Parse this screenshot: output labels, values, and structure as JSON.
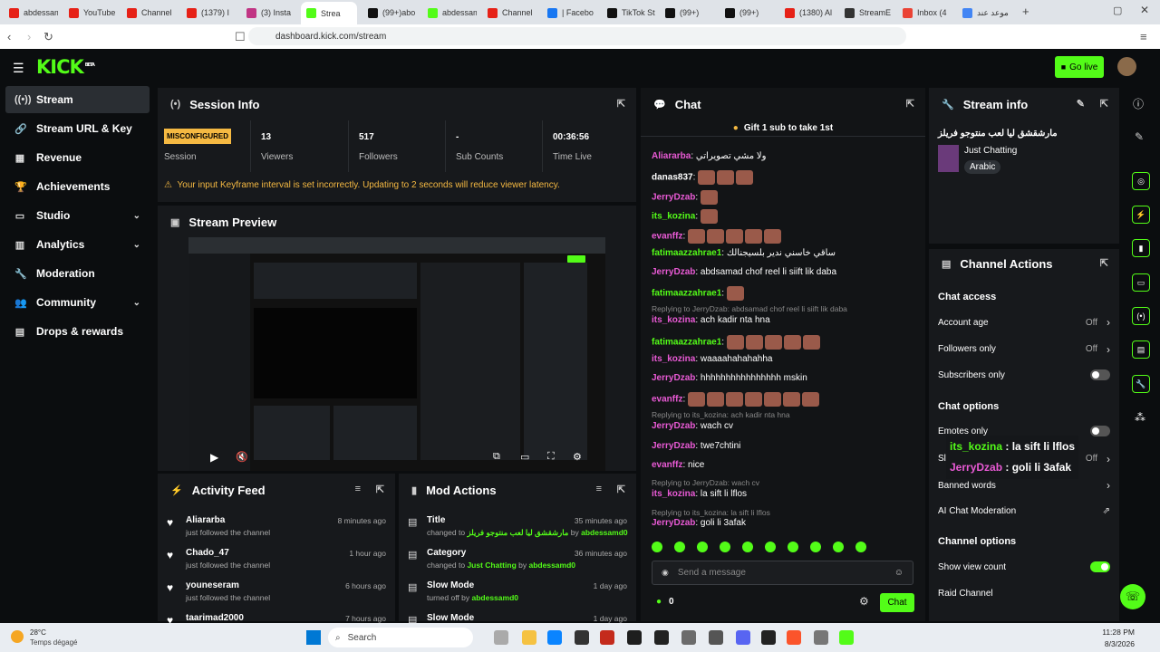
{
  "browser": {
    "tabs": [
      {
        "label": "abdessam",
        "color": "#e62117"
      },
      {
        "label": "YouTube",
        "color": "#e62117"
      },
      {
        "label": "Channel",
        "color": "#e62117"
      },
      {
        "label": "(1379) I",
        "color": "#e62117"
      },
      {
        "label": "(3) Insta",
        "color": "#c13584"
      },
      {
        "label": "Strea",
        "color": "#53fc18",
        "active": true
      },
      {
        "label": "(99+)abo",
        "color": "#111"
      },
      {
        "label": "abdessam",
        "color": "#53fc18"
      },
      {
        "label": "Channel",
        "color": "#e62117"
      },
      {
        "label": "| Facebo",
        "color": "#1877f2"
      },
      {
        "label": "TikTok St",
        "color": "#111"
      },
      {
        "label": "(99+)",
        "color": "#111"
      },
      {
        "label": "(99+)",
        "color": "#111"
      },
      {
        "label": "(1380) Al",
        "color": "#e62117"
      },
      {
        "label": "StreamE",
        "color": "#333"
      },
      {
        "label": "Inbox (4",
        "color": "#ea4335"
      },
      {
        "label": "موعد عند",
        "color": "#4285f4"
      }
    ],
    "url": "dashboard.kick.com/stream"
  },
  "app": {
    "logo": "KICK",
    "logo_sup": "BETA",
    "go_live": "Go live"
  },
  "sidebar": [
    {
      "label": "Stream",
      "icon": "stream-icon",
      "glyph": "((•))",
      "active": true
    },
    {
      "label": "Stream URL & Key",
      "icon": "link-icon",
      "glyph": "🔗"
    },
    {
      "label": "Revenue",
      "icon": "revenue-icon",
      "glyph": "▦"
    },
    {
      "label": "Achievements",
      "icon": "trophy-icon",
      "glyph": "🏆"
    },
    {
      "label": "Studio",
      "icon": "studio-icon",
      "glyph": "▭",
      "chevron": true
    },
    {
      "label": "Analytics",
      "icon": "analytics-icon",
      "glyph": "▥",
      "chevron": true
    },
    {
      "label": "Moderation",
      "icon": "wrench-icon",
      "glyph": "🔧"
    },
    {
      "label": "Community",
      "icon": "community-icon",
      "glyph": "👥",
      "chevron": true
    },
    {
      "label": "Drops & rewards",
      "icon": "drops-icon",
      "glyph": "▤"
    }
  ],
  "session": {
    "title": "Session Info",
    "status": "MISCONFIGURED",
    "status_label": "Session",
    "stats": [
      {
        "value": "13",
        "label": "Viewers"
      },
      {
        "value": "517",
        "label": "Followers"
      },
      {
        "value": "-",
        "label": "Sub Counts"
      },
      {
        "value": "00:36:56",
        "label": "Time Live"
      }
    ],
    "warning": "Your input Keyframe interval is set incorrectly. Updating to 2 seconds will reduce viewer latency."
  },
  "preview": {
    "title": "Stream Preview"
  },
  "activity": {
    "title": "Activity Feed",
    "items": [
      {
        "name": "Aliararba",
        "sub": "just followed the channel",
        "time": "8 minutes ago"
      },
      {
        "name": "Chado_47",
        "sub": "just followed the channel",
        "time": "1 hour ago"
      },
      {
        "name": "youneseram",
        "sub": "just followed the channel",
        "time": "6 hours ago"
      },
      {
        "name": "taarimad2000",
        "sub": "",
        "time": "7 hours ago"
      }
    ]
  },
  "mod": {
    "title": "Mod Actions",
    "items": [
      {
        "name": "Title",
        "pre": "changed to",
        "hl": "مارشقشق ليا لعب منتوجو فريلز",
        "mid": "by",
        "user": "abdessamd0",
        "time": "35 minutes ago"
      },
      {
        "name": "Category",
        "pre": "changed to",
        "hl": "Just Chatting",
        "mid": "by",
        "user": "abdessamd0",
        "time": "36 minutes ago"
      },
      {
        "name": "Slow Mode",
        "pre": "turned off by",
        "hl": "",
        "mid": "",
        "user": "abdessamd0",
        "time": "1 day ago"
      },
      {
        "name": "Slow Mode",
        "pre": "",
        "hl": "",
        "mid": "",
        "user": "",
        "time": "1 day ago"
      }
    ]
  },
  "chat": {
    "title": "Chat",
    "gift_banner": "Gift 1 sub to take 1st",
    "lines": [
      {
        "user": "Aliararba",
        "color": "p",
        "text": "ولا مشي تصويراتي"
      },
      {
        "user": "danas837",
        "color": "w",
        "text": "",
        "emotes": 3
      },
      {
        "user": "JerryDzab",
        "color": "p",
        "text": "",
        "emotes": 1
      },
      {
        "user": "its_kozina",
        "color": "g",
        "text": "",
        "emotes": 1
      },
      {
        "user": "evanffz",
        "color": "p",
        "text": "",
        "emotes": 5
      },
      {
        "user": "fatimaazzahrae1",
        "color": "g",
        "text": "ساقي خاسني ندير بلسيجنالك"
      },
      {
        "user": "JerryDzab",
        "color": "p",
        "text": "abdsamad chof reel li siift lik daba"
      },
      {
        "user": "fatimaazzahrae1",
        "color": "g",
        "text": "",
        "emotes": 1
      },
      {
        "reply": "Replying to JerryDzab: abdsamad chof reel li siift lik daba"
      },
      {
        "user": "its_kozina",
        "color": "p",
        "text": "ach kadir nta hna"
      },
      {
        "user": "fatimaazzahrae1",
        "color": "g",
        "text": "",
        "emotes": 5
      },
      {
        "user": "its_kozina",
        "color": "p",
        "text": "waaaahahahahha"
      },
      {
        "user": "JerryDzab",
        "color": "p",
        "text": "hhhhhhhhhhhhhhhh mskin"
      },
      {
        "user": "evanffz",
        "color": "p",
        "text": "",
        "emotes": 7
      },
      {
        "reply": "Replying to its_kozina: ach kadir nta hna"
      },
      {
        "user": "JerryDzab",
        "color": "p",
        "text": "wach cv"
      },
      {
        "user": "JerryDzab",
        "color": "p",
        "text": "twe7chtini"
      },
      {
        "user": "evanffz",
        "color": "p",
        "text": "nice"
      },
      {
        "reply": "Replying to JerryDzab: wach cv"
      },
      {
        "user": "its_kozina",
        "color": "p",
        "text": "la sift li lflos"
      },
      {
        "reply": "Replying to its_kozina: la sift li lflos"
      },
      {
        "user": "JerryDzab",
        "color": "p",
        "text": "goli li 3afak"
      }
    ],
    "placeholder": "Send a message",
    "count": "0",
    "send": "Chat"
  },
  "stream_info": {
    "title": "Stream info",
    "stream_title": "مارشقشق ليا لعب منتوجو فريلز",
    "category": "Just Chatting",
    "tag": "Arabic"
  },
  "channel_actions": {
    "title": "Channel Actions",
    "chat_access": "Chat access",
    "rows": [
      {
        "label": "Account age",
        "value": "Off",
        "type": "chevron"
      },
      {
        "label": "Followers only",
        "value": "Off",
        "type": "chevron"
      },
      {
        "label": "Subscribers only",
        "value": "",
        "type": "toggle"
      }
    ],
    "chat_options": "Chat options",
    "rows2": [
      {
        "label": "Emotes only",
        "value": "",
        "type": "toggle"
      },
      {
        "label": "Slow mode",
        "value": "Off",
        "type": "chevron"
      },
      {
        "label": "Banned words",
        "value": "",
        "type": "chevron"
      },
      {
        "label": "AI Chat Moderation",
        "value": "",
        "type": "ext"
      }
    ],
    "channel_options": "Channel options",
    "rows3": [
      {
        "label": "Show view count",
        "value": "",
        "type": "toggle-on"
      },
      {
        "label": "Raid Channel",
        "value": "",
        "type": "none"
      }
    ]
  },
  "overlay": [
    {
      "user": "its_kozina",
      "text": " : la sift li lflos"
    },
    {
      "user": "JerryDzab",
      "text": " : goli li 3afak"
    }
  ],
  "taskbar": {
    "weather": "28°C",
    "weather_sub": "Temps dégagé",
    "search": "Search",
    "time": "11:28 PM",
    "date": "8/3/2026"
  }
}
